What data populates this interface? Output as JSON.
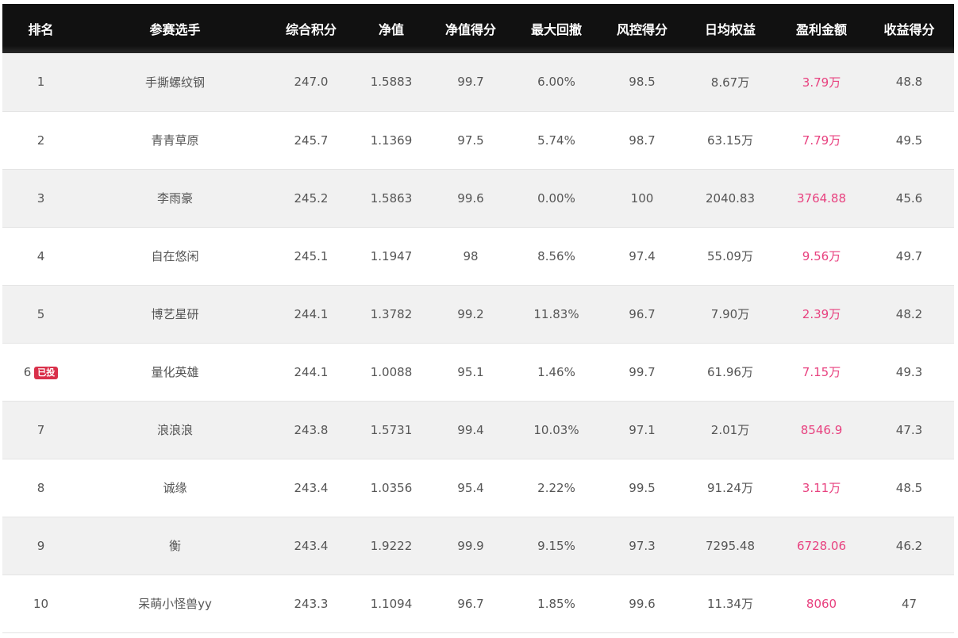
{
  "columns": [
    "排名",
    "参赛选手",
    "综合积分",
    "净值",
    "净值得分",
    "最大回撤",
    "风控得分",
    "日均权益",
    "盈利金额",
    "收益得分"
  ],
  "rows": [
    {
      "rank": "1",
      "badge": "",
      "player": "手撕螺纹钢",
      "score": "247.0",
      "nav": "1.5883",
      "nav_score": "99.7",
      "max_drawdown": "6.00%",
      "risk_score": "98.5",
      "avg_equity": "8.67万",
      "profit": "3.79万",
      "return_score": "48.8"
    },
    {
      "rank": "2",
      "badge": "",
      "player": "青青草原",
      "score": "245.7",
      "nav": "1.1369",
      "nav_score": "97.5",
      "max_drawdown": "5.74%",
      "risk_score": "98.7",
      "avg_equity": "63.15万",
      "profit": "7.79万",
      "return_score": "49.5"
    },
    {
      "rank": "3",
      "badge": "",
      "player": "李雨豪",
      "score": "245.2",
      "nav": "1.5863",
      "nav_score": "99.6",
      "max_drawdown": "0.00%",
      "risk_score": "100",
      "avg_equity": "2040.83",
      "profit": "3764.88",
      "return_score": "45.6"
    },
    {
      "rank": "4",
      "badge": "",
      "player": "自在悠闲",
      "score": "245.1",
      "nav": "1.1947",
      "nav_score": "98",
      "max_drawdown": "8.56%",
      "risk_score": "97.4",
      "avg_equity": "55.09万",
      "profit": "9.56万",
      "return_score": "49.7"
    },
    {
      "rank": "5",
      "badge": "",
      "player": "博艺星研",
      "score": "244.1",
      "nav": "1.3782",
      "nav_score": "99.2",
      "max_drawdown": "11.83%",
      "risk_score": "96.7",
      "avg_equity": "7.90万",
      "profit": "2.39万",
      "return_score": "48.2"
    },
    {
      "rank": "6",
      "badge": "已投",
      "player": "量化英雄",
      "score": "244.1",
      "nav": "1.0088",
      "nav_score": "95.1",
      "max_drawdown": "1.46%",
      "risk_score": "99.7",
      "avg_equity": "61.96万",
      "profit": "7.15万",
      "return_score": "49.3"
    },
    {
      "rank": "7",
      "badge": "",
      "player": "浪浪浪",
      "score": "243.8",
      "nav": "1.5731",
      "nav_score": "99.4",
      "max_drawdown": "10.03%",
      "risk_score": "97.1",
      "avg_equity": "2.01万",
      "profit": "8546.9",
      "return_score": "47.3"
    },
    {
      "rank": "8",
      "badge": "",
      "player": "诚缘",
      "score": "243.4",
      "nav": "1.0356",
      "nav_score": "95.4",
      "max_drawdown": "2.22%",
      "risk_score": "99.5",
      "avg_equity": "91.24万",
      "profit": "3.11万",
      "return_score": "48.5"
    },
    {
      "rank": "9",
      "badge": "",
      "player": "衡",
      "score": "243.4",
      "nav": "1.9222",
      "nav_score": "99.9",
      "max_drawdown": "9.15%",
      "risk_score": "97.3",
      "avg_equity": "7295.48",
      "profit": "6728.06",
      "return_score": "46.2"
    },
    {
      "rank": "10",
      "badge": "",
      "player": "呆萌小怪兽yy",
      "score": "243.3",
      "nav": "1.1094",
      "nav_score": "96.7",
      "max_drawdown": "1.85%",
      "risk_score": "99.6",
      "avg_equity": "11.34万",
      "profit": "8060",
      "return_score": "47"
    }
  ],
  "colors": {
    "header_bg": "#111111",
    "profit_text": "#e8417f",
    "badge_bg": "#d9304a",
    "row_alt": "#f1f1f1"
  }
}
